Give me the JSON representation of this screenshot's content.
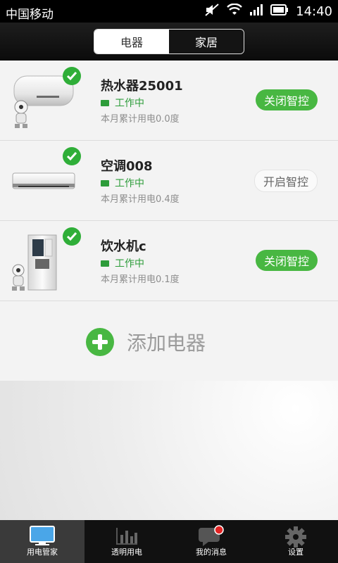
{
  "status_bar": {
    "carrier": "中国移动",
    "time": "14:40"
  },
  "segmented": {
    "tabs": [
      "电器",
      "家居"
    ],
    "active_index": 0
  },
  "devices": [
    {
      "name": "热水器25001",
      "status": "工作中",
      "usage": "本月累计用电0.0度",
      "action": "关闭智控",
      "action_state": "on",
      "image": "water-heater"
    },
    {
      "name": "空调008",
      "status": "工作中",
      "usage": "本月累计用电0.4度",
      "action": "开启智控",
      "action_state": "off",
      "image": "air-conditioner"
    },
    {
      "name": "饮水机c",
      "status": "工作中",
      "usage": "本月累计用电0.1度",
      "action": "关闭智控",
      "action_state": "on",
      "image": "water-dispenser"
    }
  ],
  "add_device": {
    "label": "添加电器"
  },
  "bottom_nav": [
    {
      "label": "用电管家",
      "icon": "monitor-icon",
      "active": true
    },
    {
      "label": "透明用电",
      "icon": "bar-chart-icon",
      "active": false
    },
    {
      "label": "我的消息",
      "icon": "message-icon",
      "active": false
    },
    {
      "label": "设置",
      "icon": "gear-icon",
      "active": false
    }
  ],
  "colors": {
    "accent_green": "#48b742",
    "status_green": "#2d9c3a",
    "badge_red": "#e32424"
  }
}
